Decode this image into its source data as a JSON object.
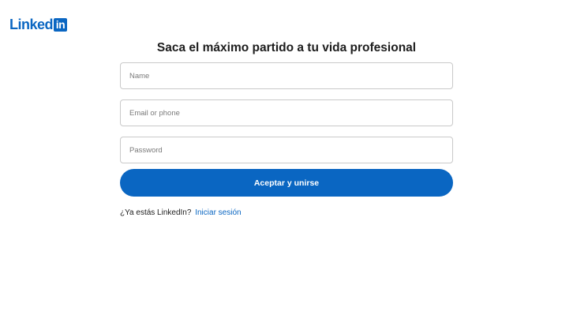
{
  "header": {
    "logo_word": "Linked",
    "logo_badge": "in"
  },
  "main": {
    "headline": "Saca el máximo partido a tu vida profesional"
  },
  "form": {
    "name_placeholder": "Name",
    "email_placeholder": "Email or phone",
    "password_placeholder": "Password",
    "submit_label": "Aceptar y unirse"
  },
  "footer": {
    "prompt": "¿Ya estás LinkedIn?",
    "signin_link": "Iniciar sesión"
  },
  "colors": {
    "brand": "#0a66c2",
    "text": "#1d1d1d",
    "border": "#c9c9c9",
    "background": "#ffffff"
  }
}
